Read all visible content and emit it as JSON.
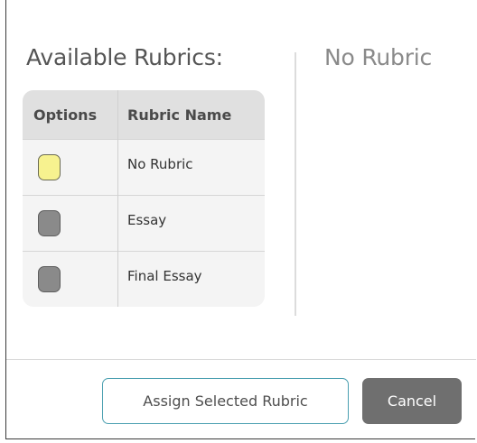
{
  "dialog": {
    "available_title": "Available Rubrics:",
    "selected_rubric_title": "No Rubric"
  },
  "table": {
    "headers": [
      "Options",
      "Rubric Name"
    ],
    "rows": [
      {
        "name": "No Rubric",
        "selected": true
      },
      {
        "name": "Essay",
        "selected": false
      },
      {
        "name": "Final Essay",
        "selected": false
      }
    ]
  },
  "buttons": {
    "assign_label": "Assign Selected Rubric",
    "cancel_label": "Cancel"
  },
  "colors": {
    "selected_option": "#f7f28f",
    "unselected_option": "#8a8a8a",
    "assign_border": "#4a9fb0",
    "cancel_bg": "#6f6f6f"
  }
}
